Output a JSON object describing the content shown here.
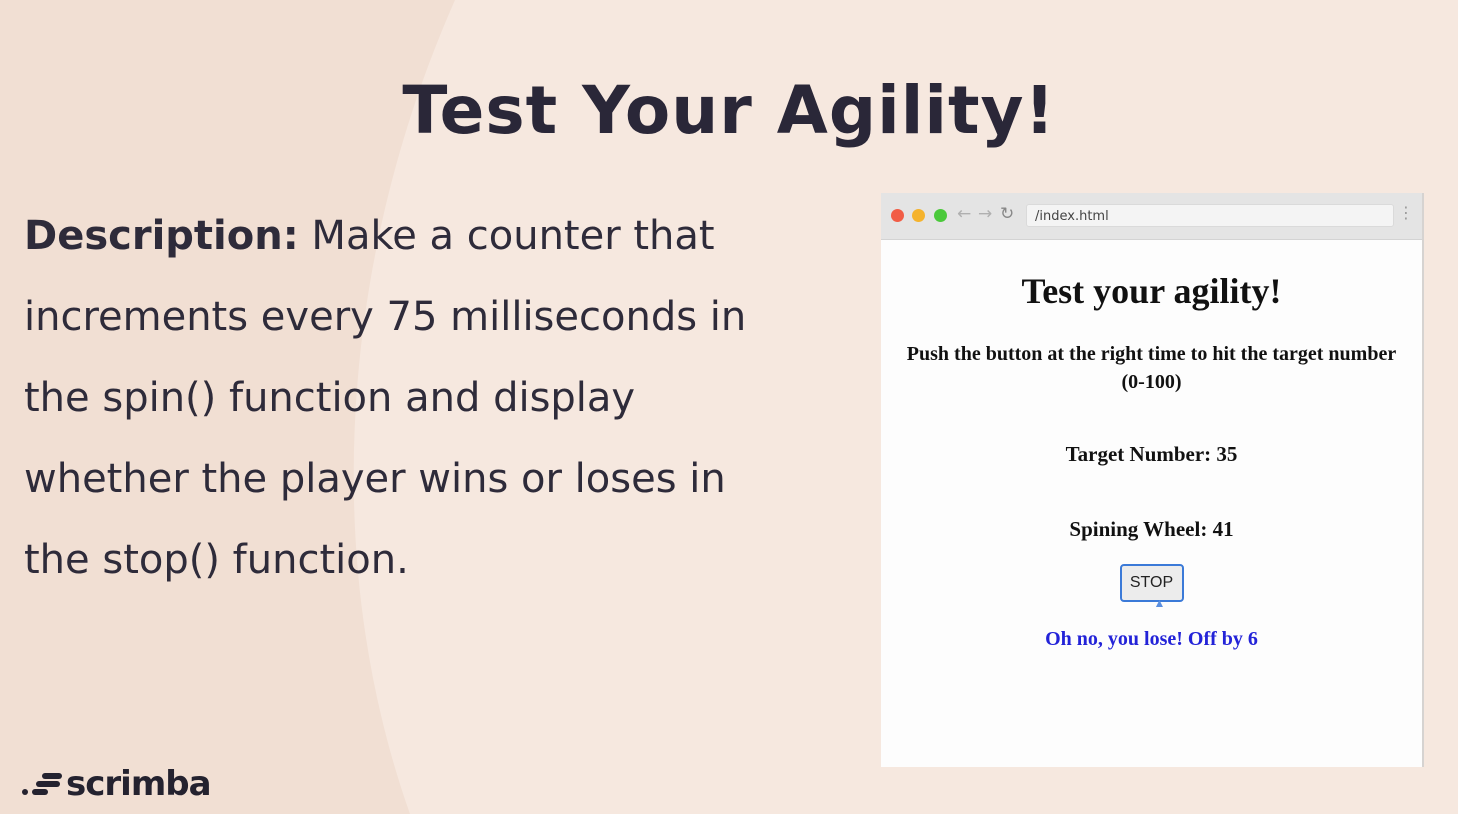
{
  "slide": {
    "title": "Test Your Agility!",
    "description_label": "Description:",
    "description_text": " Make a counter that increments every 75 milliseconds in the spin() function and display whether the player wins or loses in the stop() function."
  },
  "logo": {
    "text": "scrimba"
  },
  "browser": {
    "address": "/index.html",
    "controls": {
      "back": "←",
      "forward": "→",
      "reload": "↻",
      "menu": "⋮"
    },
    "dot_colors": [
      "#f15d46",
      "#f5b32d",
      "#4bc93b"
    ],
    "page": {
      "heading": "Test your agility!",
      "intro": "Push the button at the right time to hit the target number (0-100)",
      "target": "Target Number: 35",
      "wheel": "Spining Wheel: 41",
      "stop_label": "STOP",
      "result": "Oh no, you lose! Off by 6"
    }
  },
  "colors": {
    "background": "#f6e8df",
    "left_shape": "#f1dfd3",
    "result_text": "#2323d8",
    "button_border": "#3b7ad8"
  }
}
